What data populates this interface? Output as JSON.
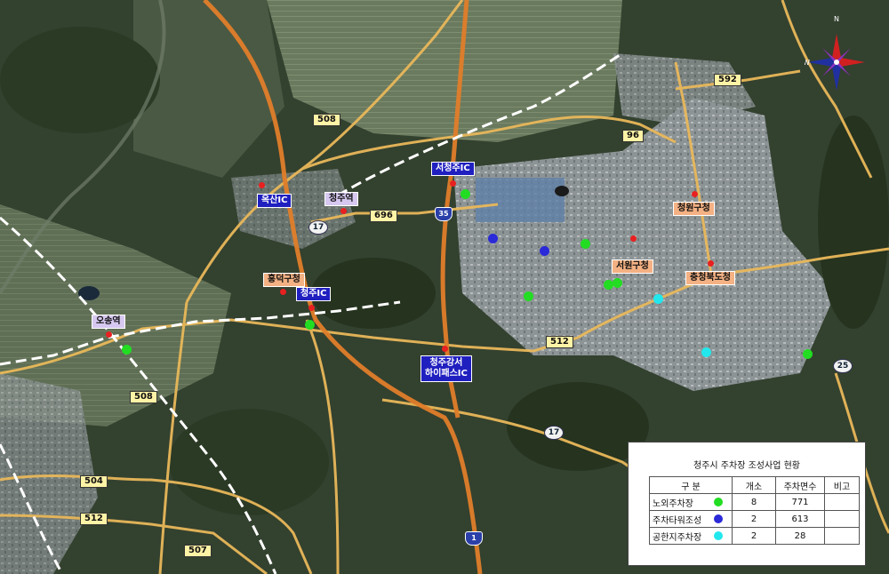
{
  "map": {
    "places": {
      "ocheon_station": "오송역",
      "cheongju_station": "청주역",
      "heungdeok_office": "흥덕구청",
      "seowon_office": "서원구청",
      "cheongwon_office": "청원구청",
      "provincial_office": "충청북도청"
    },
    "interchanges": {
      "oksan": "옥산IC",
      "cheongju": "청주IC",
      "seocheongju": "서청주IC",
      "gangseo_line1": "청주강서",
      "gangseo_line2": "하이패스IC"
    },
    "routes": {
      "r508a": "508",
      "r508b": "508",
      "r696": "696",
      "r96": "96",
      "r592": "592",
      "r512a": "512",
      "r512b": "512",
      "r504": "504",
      "r507": "507",
      "r17a": "17",
      "r17b": "17",
      "r25": "25",
      "hwy35": "35",
      "hwy1": "1"
    },
    "compass": {
      "north": "N",
      "west": "W"
    }
  },
  "legend": {
    "title": "청주시 주차장 조성사업 현황",
    "headers": {
      "category": "구    분",
      "count": "개소",
      "spaces": "주차면수",
      "note": "비고"
    },
    "rows": [
      {
        "name": "노외주차장",
        "color": "#22dd22",
        "count": "8",
        "spaces": "771",
        "note": ""
      },
      {
        "name": "주차타워조성",
        "color": "#2a2ad8",
        "count": "2",
        "spaces": "613",
        "note": ""
      },
      {
        "name": "공한지주차장",
        "color": "#22e8ee",
        "count": "2",
        "spaces": "28",
        "note": ""
      }
    ]
  },
  "colors": {
    "expressway": "#e08a3a",
    "national_road": "#f0c060",
    "railway": "#ffffff",
    "marker_red": "#e82020"
  }
}
